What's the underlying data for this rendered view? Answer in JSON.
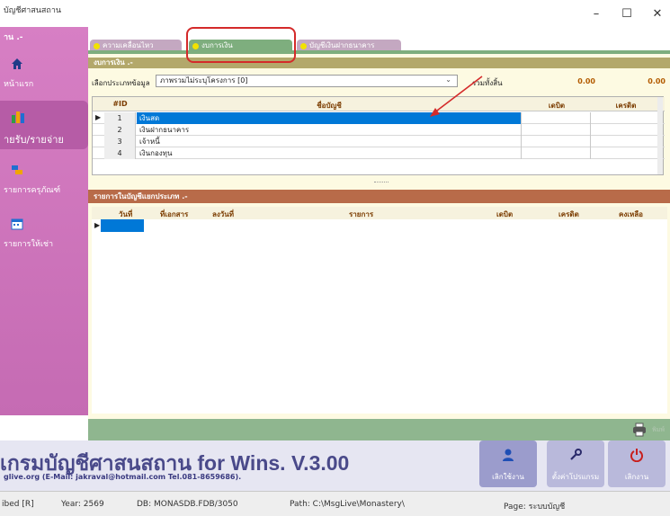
{
  "window": {
    "title": "บัญชีศาสนสถาน",
    "minimize": "–",
    "maximize": "☐",
    "close": "✕"
  },
  "sidebar": {
    "top_label": "าน .-",
    "items": [
      {
        "label": "หน้าแรก",
        "icon": "home-icon"
      },
      {
        "label": "ายรับ/รายจ่าย",
        "icon": "book-icon",
        "active": true
      },
      {
        "label": "รายการครุภัณฑ์",
        "icon": "furniture-icon"
      },
      {
        "label": "รายการให้เช่า",
        "icon": "calendar-icon"
      }
    ]
  },
  "tabs": [
    {
      "label": "ความเคลื่อนไหว"
    },
    {
      "label": "งบการเงิน",
      "active": true
    },
    {
      "label": "บัญชีเงินฝากธนาคาร"
    }
  ],
  "panel1": {
    "header": "งบการเงิน .-",
    "select_label": "เลือกประเภทข้อมูล",
    "select_value": "ภาพรวมไม่ระบุโครงการ [0]",
    "total_label": "รวมทั้งสิ้น",
    "total_debit": "0.00",
    "total_credit": "0.00",
    "columns": [
      "#ID",
      "ชื่อบัญชี",
      "เดบิต",
      "เครดิต"
    ],
    "rows": [
      {
        "id": "1",
        "name": "เงินสด"
      },
      {
        "id": "2",
        "name": "เงินฝากธนาคาร"
      },
      {
        "id": "3",
        "name": "เจ้าหนี้"
      },
      {
        "id": "4",
        "name": "เงินกองทุน"
      }
    ]
  },
  "panel2": {
    "header": "รายการในบัญชีแยกประเภท .-",
    "columns": [
      "วันที่",
      "ที่เอกสาร",
      "ลงวันที่",
      "รายการ",
      "เดบิต",
      "เครดิต",
      "คงเหลือ"
    ]
  },
  "footer": {
    "print_label": "พิมพ์",
    "app_title": "เกรมบัญชีศาสนสถาน for Wins. V.3.00",
    "contact": "glive.org (E-Mail: jakraval@hotmail.com Tel.081-8659686).",
    "buttons": [
      {
        "label": "เลิกใช้งาน",
        "icon": "user-icon"
      },
      {
        "label": "ตั้งค่าโปรแกรม",
        "icon": "wrench-icon"
      },
      {
        "label": "เลิกงาน",
        "icon": "power-icon"
      }
    ]
  },
  "statusbar": {
    "mode": "ibed [R]",
    "year": "Year: 2569",
    "db": "DB: MONASDB.FDB/3050",
    "path": "Path: C:\\MsgLive\\Monastery\\",
    "page": "Page: ระบบบัญชี"
  },
  "colors": {
    "sidebar": "#c56bb3",
    "tab_active": "#7eae7e",
    "panel_bg": "#fdfae2",
    "selection": "#0078d7",
    "annotation": "#d42a2a"
  }
}
